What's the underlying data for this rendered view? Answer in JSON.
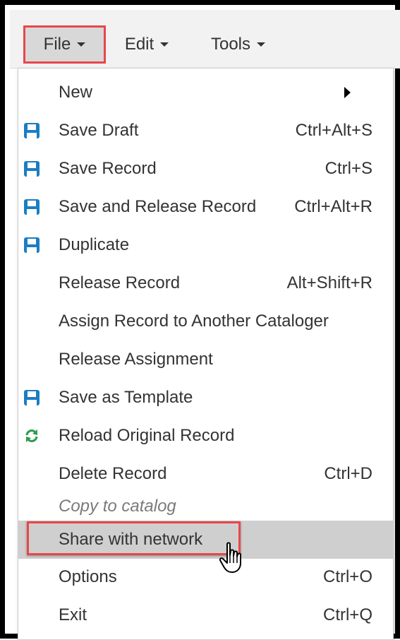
{
  "menubar": {
    "items": [
      {
        "label": "File",
        "active": true
      },
      {
        "label": "Edit",
        "active": false
      },
      {
        "label": "Tools",
        "active": false
      }
    ]
  },
  "file_menu": {
    "items": [
      {
        "label": "New",
        "shortcut": "",
        "icon": "",
        "submenu": true
      },
      {
        "label": "Save Draft",
        "shortcut": "Ctrl+Alt+S",
        "icon": "floppy-disk-icon"
      },
      {
        "label": "Save Record",
        "shortcut": "Ctrl+S",
        "icon": "floppy-disk-icon"
      },
      {
        "label": "Save and Release Record",
        "shortcut": "Ctrl+Alt+R",
        "icon": "floppy-disk-icon"
      },
      {
        "label": "Duplicate",
        "shortcut": "",
        "icon": "floppy-disk-icon"
      },
      {
        "label": "Release Record",
        "shortcut": "Alt+Shift+R",
        "icon": ""
      },
      {
        "label": "Assign Record to Another Cataloger",
        "shortcut": "",
        "icon": ""
      },
      {
        "label": "Release Assignment",
        "shortcut": "",
        "icon": ""
      },
      {
        "label": "Save as Template",
        "shortcut": "",
        "icon": "floppy-disk-icon"
      },
      {
        "label": "Reload Original Record",
        "shortcut": "",
        "icon": "refresh-arrows-icon"
      },
      {
        "label": "Delete Record",
        "shortcut": "Ctrl+D",
        "icon": ""
      },
      {
        "label": "Copy to catalog",
        "shortcut": "",
        "icon": "",
        "disabled": true
      },
      {
        "label": "Share with network",
        "shortcut": "",
        "icon": "",
        "hovered": true
      },
      {
        "label": "Options",
        "shortcut": "Ctrl+O",
        "icon": ""
      },
      {
        "label": "Exit",
        "shortcut": "Ctrl+Q",
        "icon": ""
      }
    ]
  },
  "colors": {
    "highlight_red": "#e8474b",
    "save_icon_blue": "#1b7ec2",
    "reload_icon_green": "#2e9c4a",
    "hover_gray": "#cfcfcf"
  }
}
